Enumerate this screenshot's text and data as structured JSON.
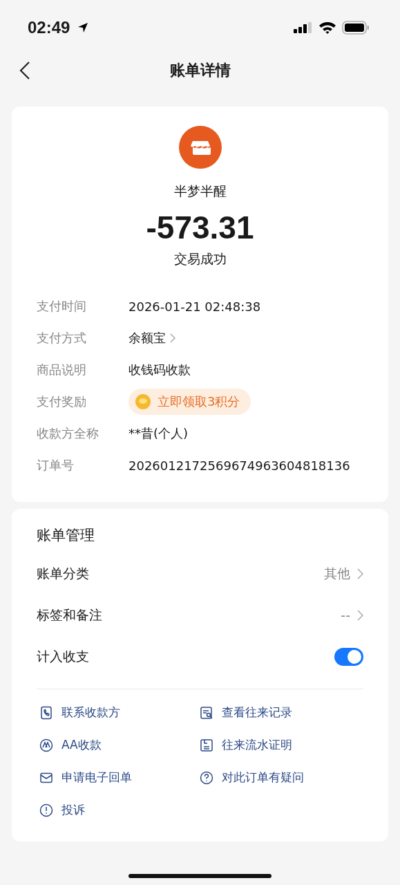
{
  "status_bar": {
    "time": "02:49"
  },
  "nav": {
    "title": "账单详情"
  },
  "summary": {
    "merchant": "半梦半醒",
    "amount": "-573.31",
    "status": "交易成功"
  },
  "details": [
    {
      "kind": "text",
      "label": "支付时间",
      "value": "2026-01-21 02:48:38"
    },
    {
      "kind": "link",
      "label": "支付方式",
      "value": "余额宝"
    },
    {
      "kind": "text",
      "label": "商品说明",
      "value": "收钱码收款"
    },
    {
      "kind": "reward",
      "label": "支付奖励",
      "value": "立即领取3积分"
    },
    {
      "kind": "text",
      "label": "收款方全称",
      "value": "**昔(个人)"
    },
    {
      "kind": "text",
      "label": "订单号",
      "value": "2026012172569674963604818136"
    }
  ],
  "management": {
    "title": "账单管理",
    "rows": [
      {
        "kind": "link",
        "label": "账单分类",
        "value": "其他"
      },
      {
        "kind": "link",
        "label": "标签和备注",
        "value": "--"
      },
      {
        "kind": "toggle",
        "label": "计入收支",
        "on": true
      }
    ]
  },
  "actions": [
    {
      "label": "联系收款方"
    },
    {
      "label": "查看往来记录"
    },
    {
      "label": "AA收款"
    },
    {
      "label": "往来流水证明"
    },
    {
      "label": "申请电子回单"
    },
    {
      "label": "对此订单有疑问"
    },
    {
      "label": "投诉"
    }
  ]
}
